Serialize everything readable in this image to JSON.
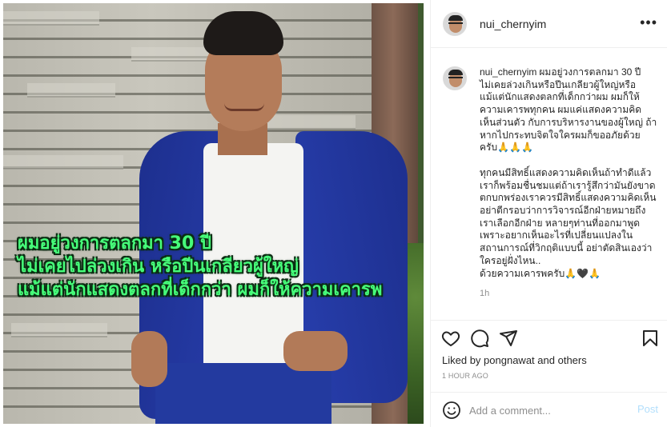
{
  "post": {
    "username": "nui_chernyim",
    "image_caption_lines": [
      "ผมอยู่วงการตลกมา 30 ปี",
      "ไม่เคยไปล่วงเกิน หรือปีนเกลียวผู้ใหญ่",
      "แม้แต่นักแสดงตลกที่เด็กกว่า ผมก็ให้ความเคารพ"
    ],
    "caption": {
      "username": "nui_chernyim",
      "paragraph1": "ผมอยู่วงการตลกมา 30 ปี\nไม่เคยล่วงเกินหรือปีนเกลียวผู้ใหญ่หรือแม้แต่นักแสดงตลกที่เด็กกว่าผม ผมก็ให้ความเคารพทุกคน ผมแค่แสดงความคิดเห็นส่วนตัว กับการบริหารงานของผู้ใหญ่ ถ้าหากไปกระทบจิตใจใครผมก็ขออภัยด้วยครับ🙏🙏🙏",
      "paragraph2": "ทุกคนมีสิทธิ์แสดงความคิดเห็นถ้าทำดีแล้วเราก็พร้อมชื่นชมแต่ถ้าเรารู้สึกว่ามันยังขาดตกบกพร่องเราควรมีสิทธิ์แสดงความคิดเห็น อย่าตีกรอบว่าการวิจารณ์อีกฝ่ายหมายถึงเราเลือกอีกฝ่าย หลายๆท่านที่ออกมาพูดเพราะอยากเห็นอะไรที่เปลี่ยนแปลงในสถานการณ์ที่วิกฤติแบบนี้ อย่าตัดสินเองว่าใครอยู่ฝั่งไหน..\nด้วยความเคารพครับ🙏🖤🙏",
      "time": "1h"
    },
    "likes_prefix": "Liked by",
    "liked_by_user": "pongnawat",
    "likes_suffix": "and others",
    "post_age": "1 HOUR AGO"
  },
  "comment_box": {
    "placeholder": "Add a comment...",
    "post_label": "Post"
  },
  "icons": {
    "more": "more-options-icon",
    "like": "heart-icon",
    "comment": "comment-bubble-icon",
    "share": "paper-plane-icon",
    "save": "bookmark-icon",
    "emoji": "emoji-smile-icon"
  },
  "colors": {
    "caption_overlay_text": "#46ff7a",
    "link_button_disabled": "#b2dffc",
    "meta_text": "#8e8e8e"
  }
}
